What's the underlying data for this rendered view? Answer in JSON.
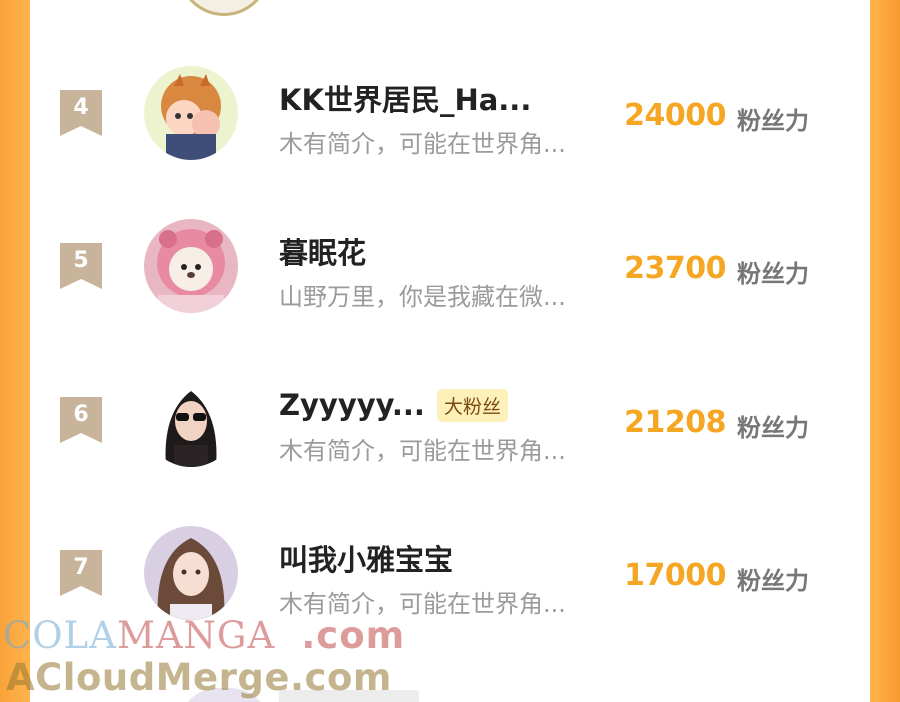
{
  "ranking": [
    {
      "rank": "4",
      "name": "KK世界居民_Ha...",
      "bio": "木有简介，可能在世界角...",
      "score": "24000",
      "unit": "粉丝力",
      "tag": ""
    },
    {
      "rank": "5",
      "name": "暮眠花",
      "bio": "山野万里，你是我藏在微...",
      "score": "23700",
      "unit": "粉丝力",
      "tag": ""
    },
    {
      "rank": "6",
      "name": "Zyyyyy...",
      "bio": "木有简介，可能在世界角...",
      "score": "21208",
      "unit": "粉丝力",
      "tag": "大粉丝"
    },
    {
      "rank": "7",
      "name": "叫我小雅宝宝",
      "bio": "木有简介，可能在世界角...",
      "score": "17000",
      "unit": "粉丝力",
      "tag": ""
    }
  ],
  "watermark": {
    "line1_part1": "COLA",
    "line1_part2": "MANGA",
    "line1_part3": ".com",
    "line2": "ACloudMerge.com"
  },
  "colors": {
    "accent_score": "#f5a623",
    "badge": "#c8b39b",
    "background_orange": "#ffb24a",
    "tag_background": "#fdf0b9"
  },
  "icons": {
    "rank_badge": "ribbon-badge-icon"
  }
}
